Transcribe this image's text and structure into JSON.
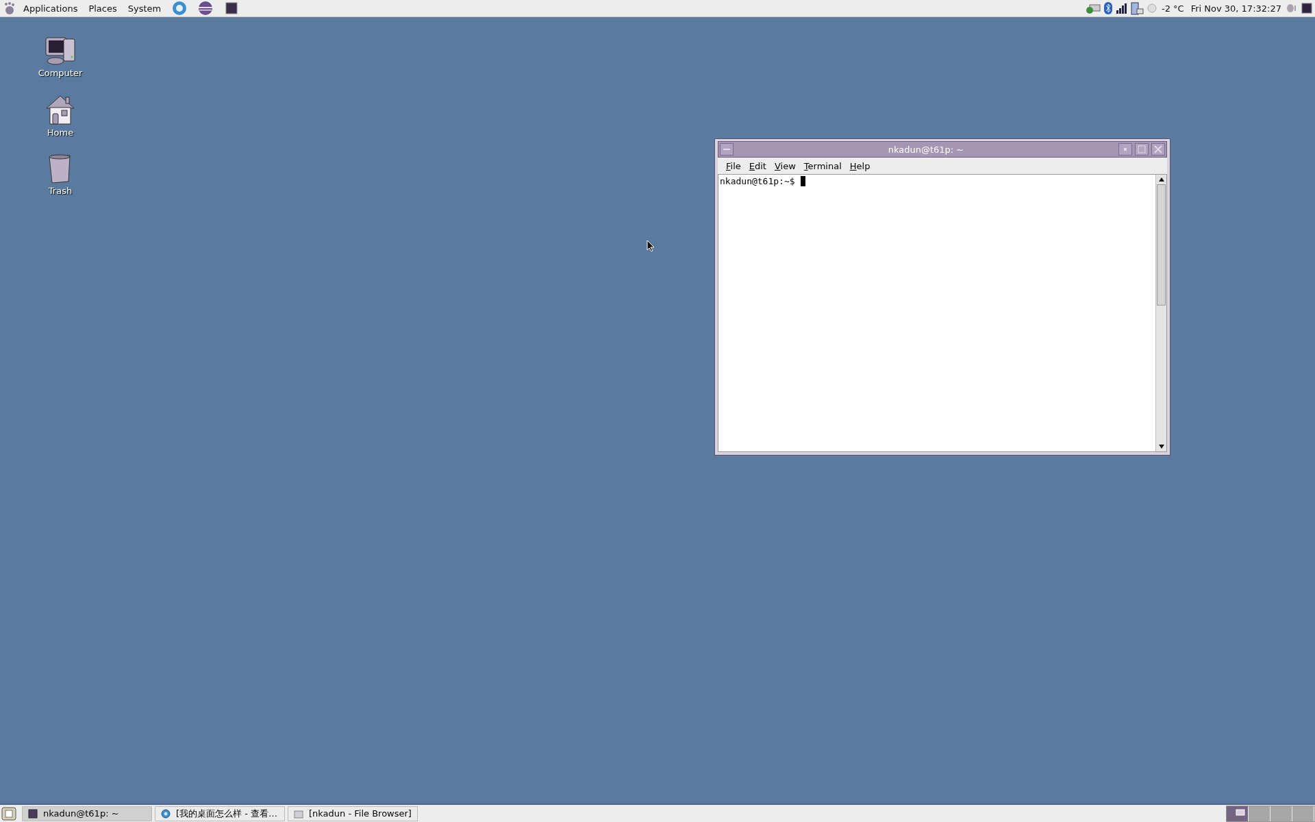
{
  "top_panel": {
    "menus": [
      "Applications",
      "Places",
      "System"
    ],
    "temperature": "-2 °C",
    "clock": "Fri Nov 30, 17:32:27"
  },
  "desktop_icons": [
    {
      "label": "Computer",
      "kind": "computer"
    },
    {
      "label": "Home",
      "kind": "home"
    },
    {
      "label": "Trash",
      "kind": "trash"
    }
  ],
  "terminal": {
    "title": "nkadun@t61p: ~",
    "menu": [
      "File",
      "Edit",
      "View",
      "Terminal",
      "Help"
    ],
    "prompt": "nkadun@t61p:~$ "
  },
  "taskbar": {
    "tasks": [
      {
        "label": "nkadun@t61p: ~",
        "kind": "terminal",
        "selected": true
      },
      {
        "label": "[我的桌面怎么样 - 查看…",
        "kind": "browser",
        "selected": false
      },
      {
        "label": "[nkadun - File Browser]",
        "kind": "files",
        "selected": false
      }
    ],
    "workspaces": [
      {
        "selected": true
      },
      {
        "selected": false
      },
      {
        "selected": false
      },
      {
        "selected": false
      }
    ]
  }
}
